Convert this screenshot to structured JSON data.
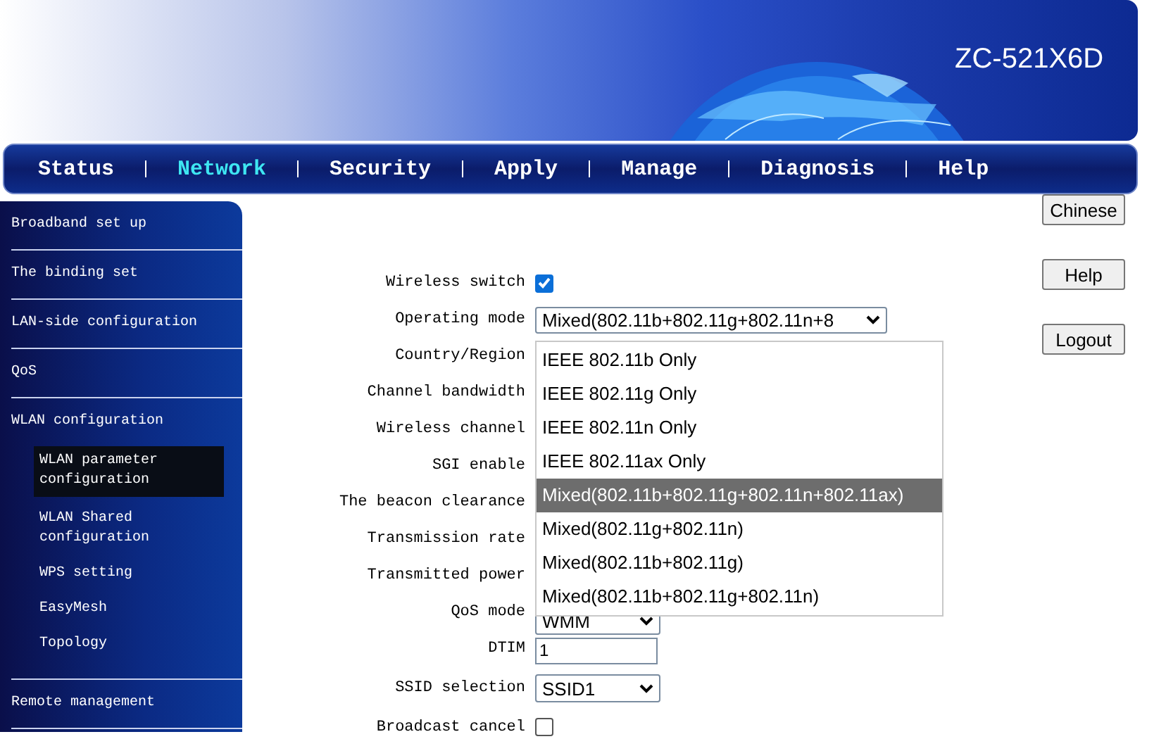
{
  "header": {
    "model": "ZC-521X6D"
  },
  "nav": [
    {
      "label": "Status",
      "selected": false
    },
    {
      "label": "Network",
      "selected": true
    },
    {
      "label": "Security",
      "selected": false
    },
    {
      "label": "Apply",
      "selected": false
    },
    {
      "label": "Manage",
      "selected": false
    },
    {
      "label": "Diagnosis",
      "selected": false
    },
    {
      "label": "Help",
      "selected": false
    }
  ],
  "sidebar": [
    {
      "label": "Broadband set up",
      "selected": false
    },
    {
      "label": "The binding set",
      "selected": false
    },
    {
      "label": "LAN-side configuration",
      "selected": false
    },
    {
      "label": "QoS",
      "selected": false
    },
    {
      "label": "WLAN configuration",
      "selected": false,
      "children": [
        {
          "label": "WLAN parameter configuration",
          "selected": true
        },
        {
          "label": "WLAN Shared configuration",
          "selected": false
        },
        {
          "label": "WPS setting",
          "selected": false
        },
        {
          "label": "EasyMesh",
          "selected": false
        },
        {
          "label": "Topology",
          "selected": false
        }
      ]
    },
    {
      "label": "Remote management",
      "selected": false
    }
  ],
  "form": {
    "rows": [
      {
        "label": "Wireless switch",
        "kind": "checkbox",
        "checked": true
      },
      {
        "label": "Operating mode",
        "kind": "select",
        "value": "Mixed(802.11b+802.11g+802.11n+8"
      },
      {
        "label": "Country/Region"
      },
      {
        "label": "Channel bandwidth"
      },
      {
        "label": "Wireless channel"
      },
      {
        "label": "SGI enable"
      },
      {
        "label": "The beacon clearance"
      },
      {
        "label": "Transmission rate"
      },
      {
        "label": "Transmitted power"
      },
      {
        "label": "QoS mode",
        "kind": "select",
        "value": "WMM"
      },
      {
        "label": "DTIM",
        "kind": "input",
        "value": "1"
      },
      {
        "label": "SSID selection",
        "kind": "select",
        "value": "SSID1"
      },
      {
        "label": "Broadcast cancel",
        "kind": "checkbox",
        "checked": false
      }
    ],
    "dropdown": {
      "options": [
        {
          "label": "IEEE 802.11b Only",
          "selected": false
        },
        {
          "label": "IEEE 802.11g Only",
          "selected": false
        },
        {
          "label": "IEEE 802.11n Only",
          "selected": false
        },
        {
          "label": "IEEE 802.11ax Only",
          "selected": false
        },
        {
          "label": "Mixed(802.11b+802.11g+802.11n+802.11ax)",
          "selected": true
        },
        {
          "label": "Mixed(802.11g+802.11n)",
          "selected": false
        },
        {
          "label": "Mixed(802.11b+802.11g)",
          "selected": false
        },
        {
          "label": "Mixed(802.11b+802.11g+802.11n)",
          "selected": false
        }
      ]
    }
  },
  "buttons": [
    "Chinese",
    "Help",
    "Logout"
  ]
}
